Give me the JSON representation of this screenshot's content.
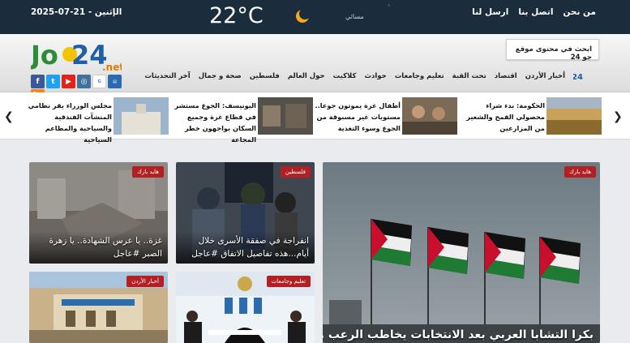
{
  "topbar": {
    "date": "2025-07-21 - الإثنين",
    "temperature": "22°C",
    "time_of_day": "مسائي",
    "weather_icon": "moon-cloud-icon",
    "links": [
      "من نحن",
      "اتصل بنا",
      "ارسل لنا"
    ]
  },
  "header": {
    "logo_text": "Jo24.net",
    "search_placeholder": "ابحث في محتوى موقع جو 24",
    "social": [
      "facebook-icon",
      "twitter-icon",
      "youtube-icon",
      "instagram-icon",
      "google-news-icon",
      "news-app-icon"
    ],
    "nav": [
      "أخبار الأردن",
      "اقتصاد",
      "تحت القبة",
      "تعليم وجامعات",
      "حوادث",
      "كلاكيت",
      "حول العالم",
      "فلسطين",
      "صحة و جمال",
      "آخر التحديثات"
    ]
  },
  "ticker": {
    "items": [
      "الحكومة: بدء شراء محصولي القمح والشعير من المزارعين",
      "أطفال غزة يموتون جوعا.. مستويات غير مسبوقة من الجوع وسوء التغذية",
      "اليونيسف: الجوع مستشر في قطاع غزة وجميع السكان يواجهون خطر المجاعة",
      "مجلس الوزراء يقر نظامي المنشآت الفندقية والسياحية والمطاعم السياحية"
    ]
  },
  "cards": {
    "main": {
      "badge": "هايد بارك",
      "caption": "بكرا التشابا العربي بعد الانتخابات يخاطب الرعب موسسا"
    },
    "c1": {
      "badge": "فلسطين",
      "caption": "انفراجة في صفقة الأسرى خلال أيام...هذه تفاصيل الاتفاق #عاجل"
    },
    "c2": {
      "badge": "هايد بارك",
      "caption": "غزة.. يا عرس الشهادة.. يا زهرة الصبر #عاجل"
    },
    "c3": {
      "badge": "تعليم وجامعات",
      "caption": ""
    },
    "c4": {
      "badge": "أخبار الأردن",
      "caption": ""
    }
  },
  "colors": {
    "topbar": "#1b2c3c",
    "badge": "#b32024",
    "accent_green": "#2e8b3a"
  }
}
